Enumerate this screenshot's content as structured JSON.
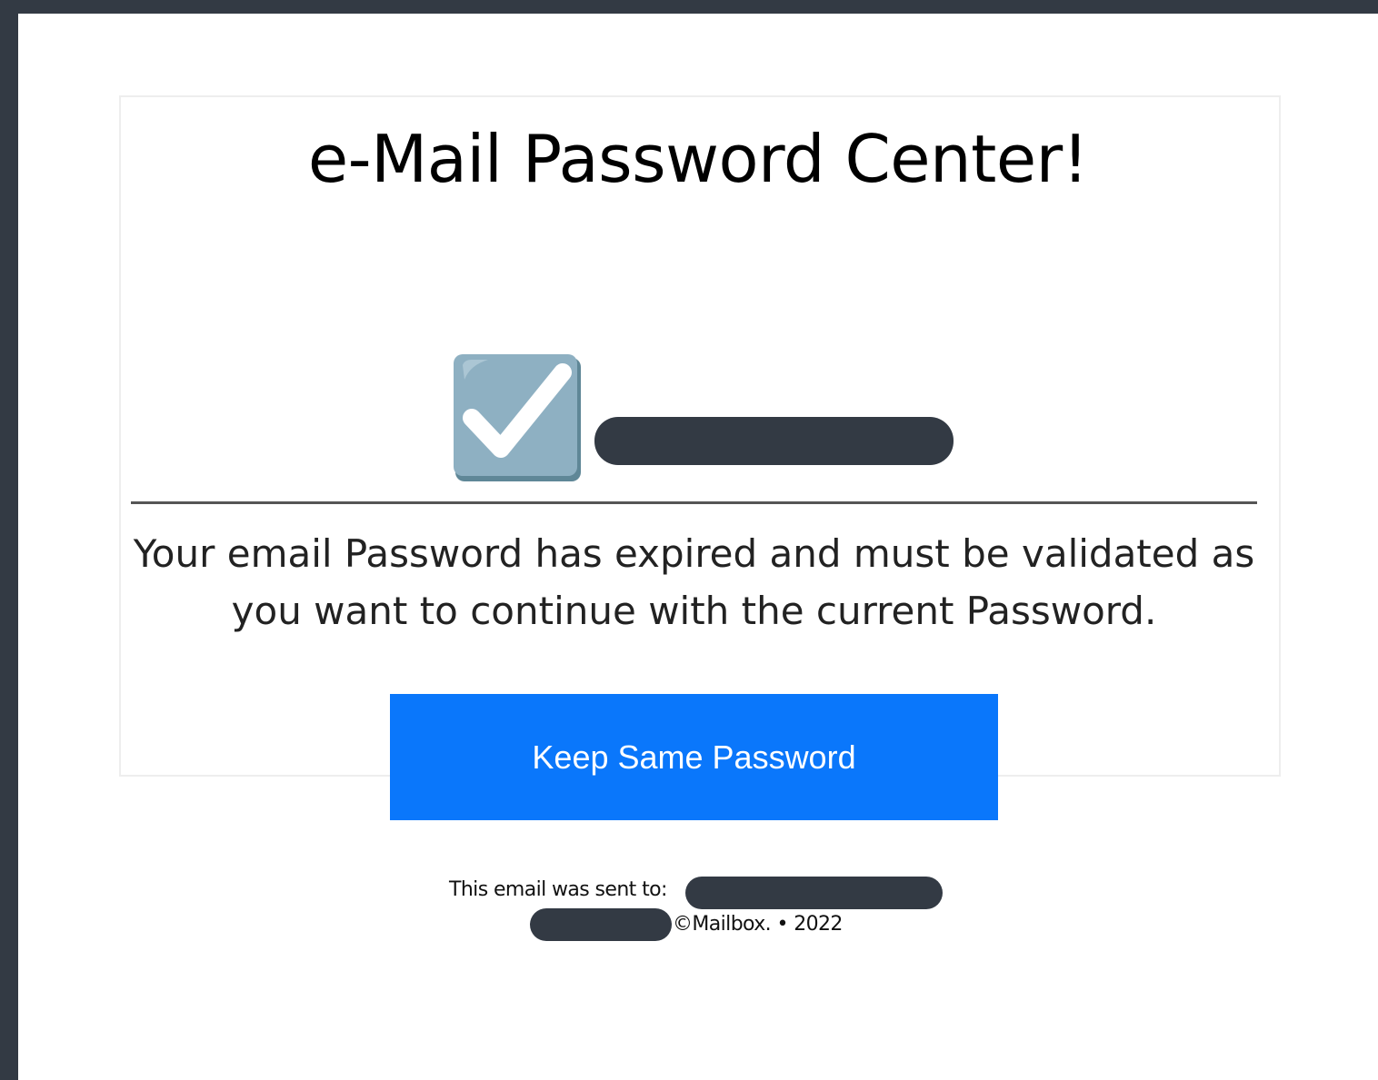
{
  "email": {
    "title": "e-Mail Password Center!",
    "status_icon": "check-box-icon",
    "message": "Your email Password has expired and must be validated as you want to continue with the current Password.",
    "cta_label": "Keep Same Password",
    "footer": {
      "sent_to_label": "This email was sent to:",
      "copyright": "©Mailbox. • 2022"
    }
  },
  "colors": {
    "background_frame": "#333a44",
    "button": "#0a77fb",
    "check_box": "#8eb0c2"
  }
}
